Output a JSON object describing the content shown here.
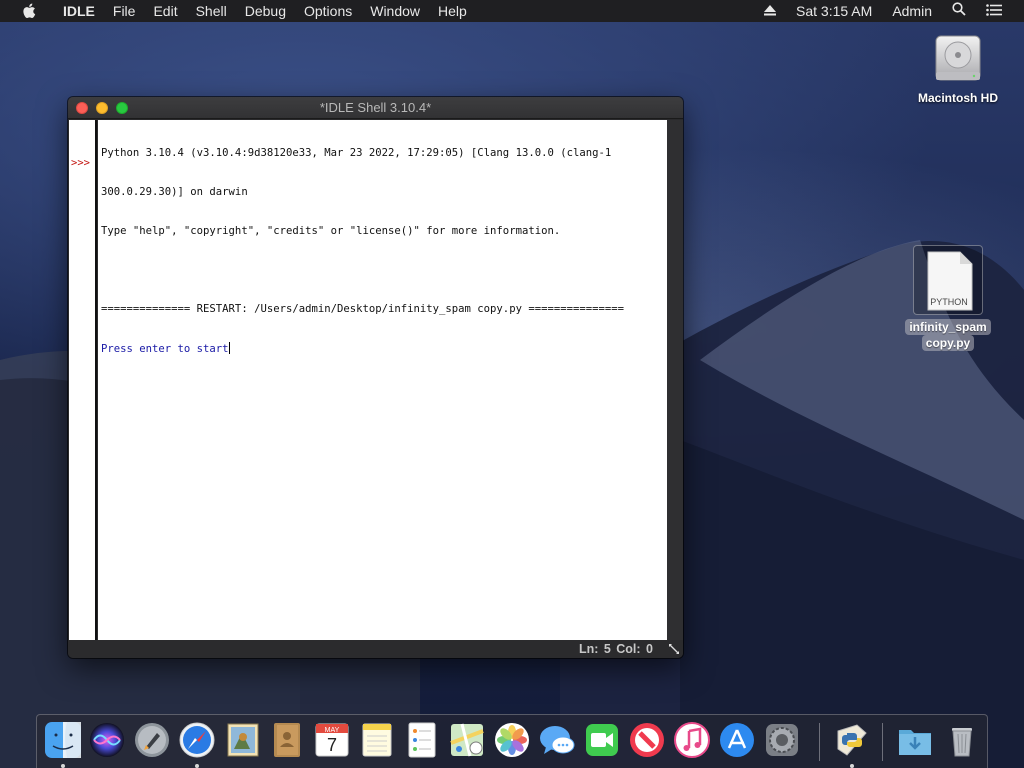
{
  "menubar": {
    "apple_icon": "apple-icon",
    "app_name": "IDLE",
    "menus": [
      "File",
      "Edit",
      "Shell",
      "Debug",
      "Options",
      "Window",
      "Help"
    ],
    "clock": "Sat 3:15 AM",
    "user": "Admin",
    "eject_icon": "eject-icon",
    "spotlight_icon": "search-icon",
    "notification_icon": "list-icon"
  },
  "desktop": {
    "hd_label": "Macintosh HD",
    "file_label_line1": "infinity_spam",
    "file_label_line2": "copy.py",
    "file_badge": "PYTHON"
  },
  "window": {
    "title": "*IDLE Shell 3.10.4*",
    "prompt": ">>>",
    "lines": [
      "Python 3.10.4 (v3.10.4:9d38120e33, Mar 23 2022, 17:29:05) [Clang 13.0.0 (clang-1",
      "300.0.29.30)] on darwin",
      "Type \"help\", \"copyright\", \"credits\" or \"license()\" for more information.",
      "",
      "============== RESTART: /Users/admin/Desktop/infinity_spam copy.py ==============="
    ],
    "input_line": "Press enter to start",
    "status": "Ln: 5  Col: 0"
  },
  "dock": {
    "apps": [
      "finder-icon",
      "siri-icon",
      "launchpad-icon",
      "safari-icon",
      "mail-icon",
      "contacts-icon",
      "calendar-icon",
      "notes-icon",
      "reminders-icon",
      "maps-icon",
      "photos-icon",
      "messages-icon",
      "facetime-icon",
      "news-icon",
      "music-icon",
      "app-store-icon",
      "system-preferences-icon",
      "python-launcher-icon",
      "downloads-icon",
      "trash-icon"
    ],
    "calendar_month": "MAY",
    "calendar_day": "7"
  }
}
